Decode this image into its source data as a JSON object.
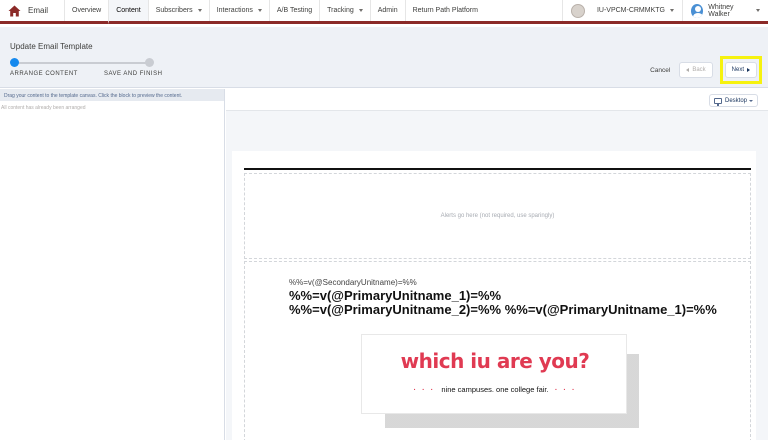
{
  "nav": {
    "app_name": "Email",
    "items": [
      {
        "label": "Overview",
        "caret": false,
        "active": false
      },
      {
        "label": "Content",
        "caret": false,
        "active": true
      },
      {
        "label": "Subscribers",
        "caret": true,
        "active": false
      },
      {
        "label": "Interactions",
        "caret": true,
        "active": false
      },
      {
        "label": "A/B Testing",
        "caret": false,
        "active": false
      },
      {
        "label": "Tracking",
        "caret": true,
        "active": false
      },
      {
        "label": "Admin",
        "caret": false,
        "active": false
      },
      {
        "label": "Return Path Platform",
        "caret": false,
        "active": false
      }
    ],
    "business_unit": "IU-VPCM-CRMMKTG",
    "user_name": "Whitney Walker",
    "accent_color": "#8b2a28"
  },
  "header": {
    "title": "Update Email Template",
    "steps": [
      {
        "label": "ARRANGE CONTENT",
        "state": "active"
      },
      {
        "label": "SAVE AND FINISH",
        "state": "inactive"
      }
    ],
    "cancel_label": "Cancel",
    "back_label": "Back",
    "next_label": "Next"
  },
  "sidebar": {
    "hint": "Drag your content to the template canvas. Click the block to preview the content.",
    "empty_text": "All content has already been arranged"
  },
  "canvas": {
    "device_label": "Desktop",
    "alerts_placeholder": "Alerts go here (not required, use sparingly)",
    "secondary_unit": "%%=v(@SecondaryUnitname)=%%",
    "primary_line_1": "%%=v(@PrimaryUnitname_1)=%%",
    "primary_line_2": "%%=v(@PrimaryUnitname_2)=%% %%=v(@PrimaryUnitname_1)=%%",
    "banner_headline": "which iu are you?",
    "banner_dots_left": "· · ·",
    "banner_subtitle": "nine campuses. one college fair.",
    "banner_dots_right": "· · ·",
    "banner_color": "#e03a52"
  }
}
